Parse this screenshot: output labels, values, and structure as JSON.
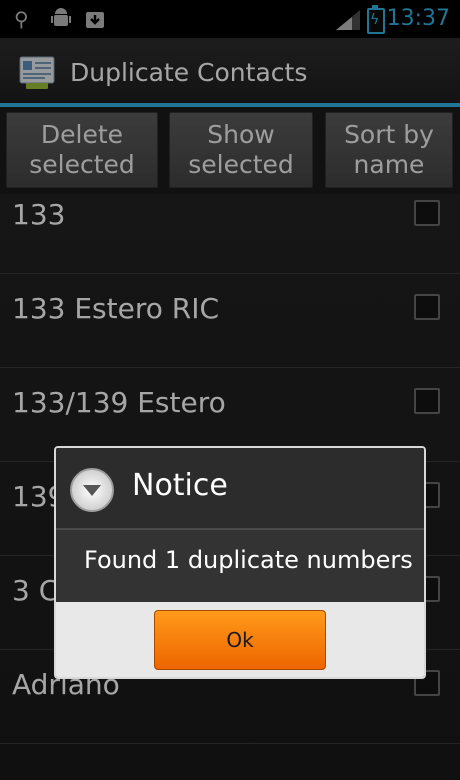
{
  "status_bar": {
    "time": "13:37",
    "icons": [
      "usb-icon",
      "android-debug-icon",
      "download-icon",
      "signal-icon",
      "battery-charging-icon"
    ]
  },
  "app": {
    "title": "Duplicate Contacts",
    "icon": "contacts-list-icon",
    "accent_color": "#33b5e5"
  },
  "buttons": {
    "delete_line1": "Delete",
    "delete_line2": "selected",
    "show_line1": "Show",
    "show_line2": "selected",
    "sort_line1": "Sort by",
    "sort_line2": "name"
  },
  "list": {
    "items": [
      {
        "label": "133",
        "checked": false
      },
      {
        "label": "133 Estero RIC",
        "checked": false
      },
      {
        "label": "133/139 Estero",
        "checked": false
      },
      {
        "label": "139",
        "checked": false
      },
      {
        "label": "3 C",
        "checked": false
      },
      {
        "label": "Adriano",
        "checked": false
      }
    ]
  },
  "dialog": {
    "title": "Notice",
    "message": "Found 1 duplicate numbers",
    "ok_label": "Ok",
    "button_color": "#f47b00"
  }
}
